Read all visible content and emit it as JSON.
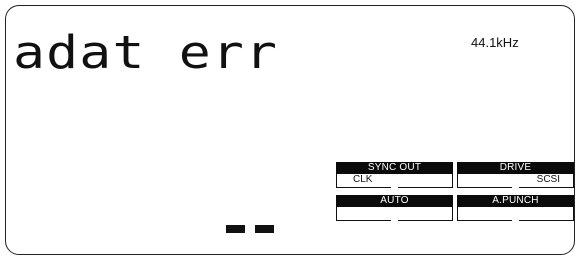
{
  "display": {
    "main_text": "adat err",
    "sample_rate": "44.1kHz"
  },
  "indicators": {
    "sync_out": {
      "label": "SYNC OUT",
      "sub_left": "CLK",
      "sub_right": ""
    },
    "drive": {
      "label": "DRIVE",
      "sub_left": "",
      "sub_right": "SCSI"
    },
    "auto": {
      "label": "AUTO",
      "sub_left": "",
      "sub_right": ""
    },
    "a_punch": {
      "label": "A.PUNCH",
      "sub_left": "",
      "sub_right": ""
    }
  },
  "segments": {
    "count": 2,
    "color": "#111111"
  }
}
